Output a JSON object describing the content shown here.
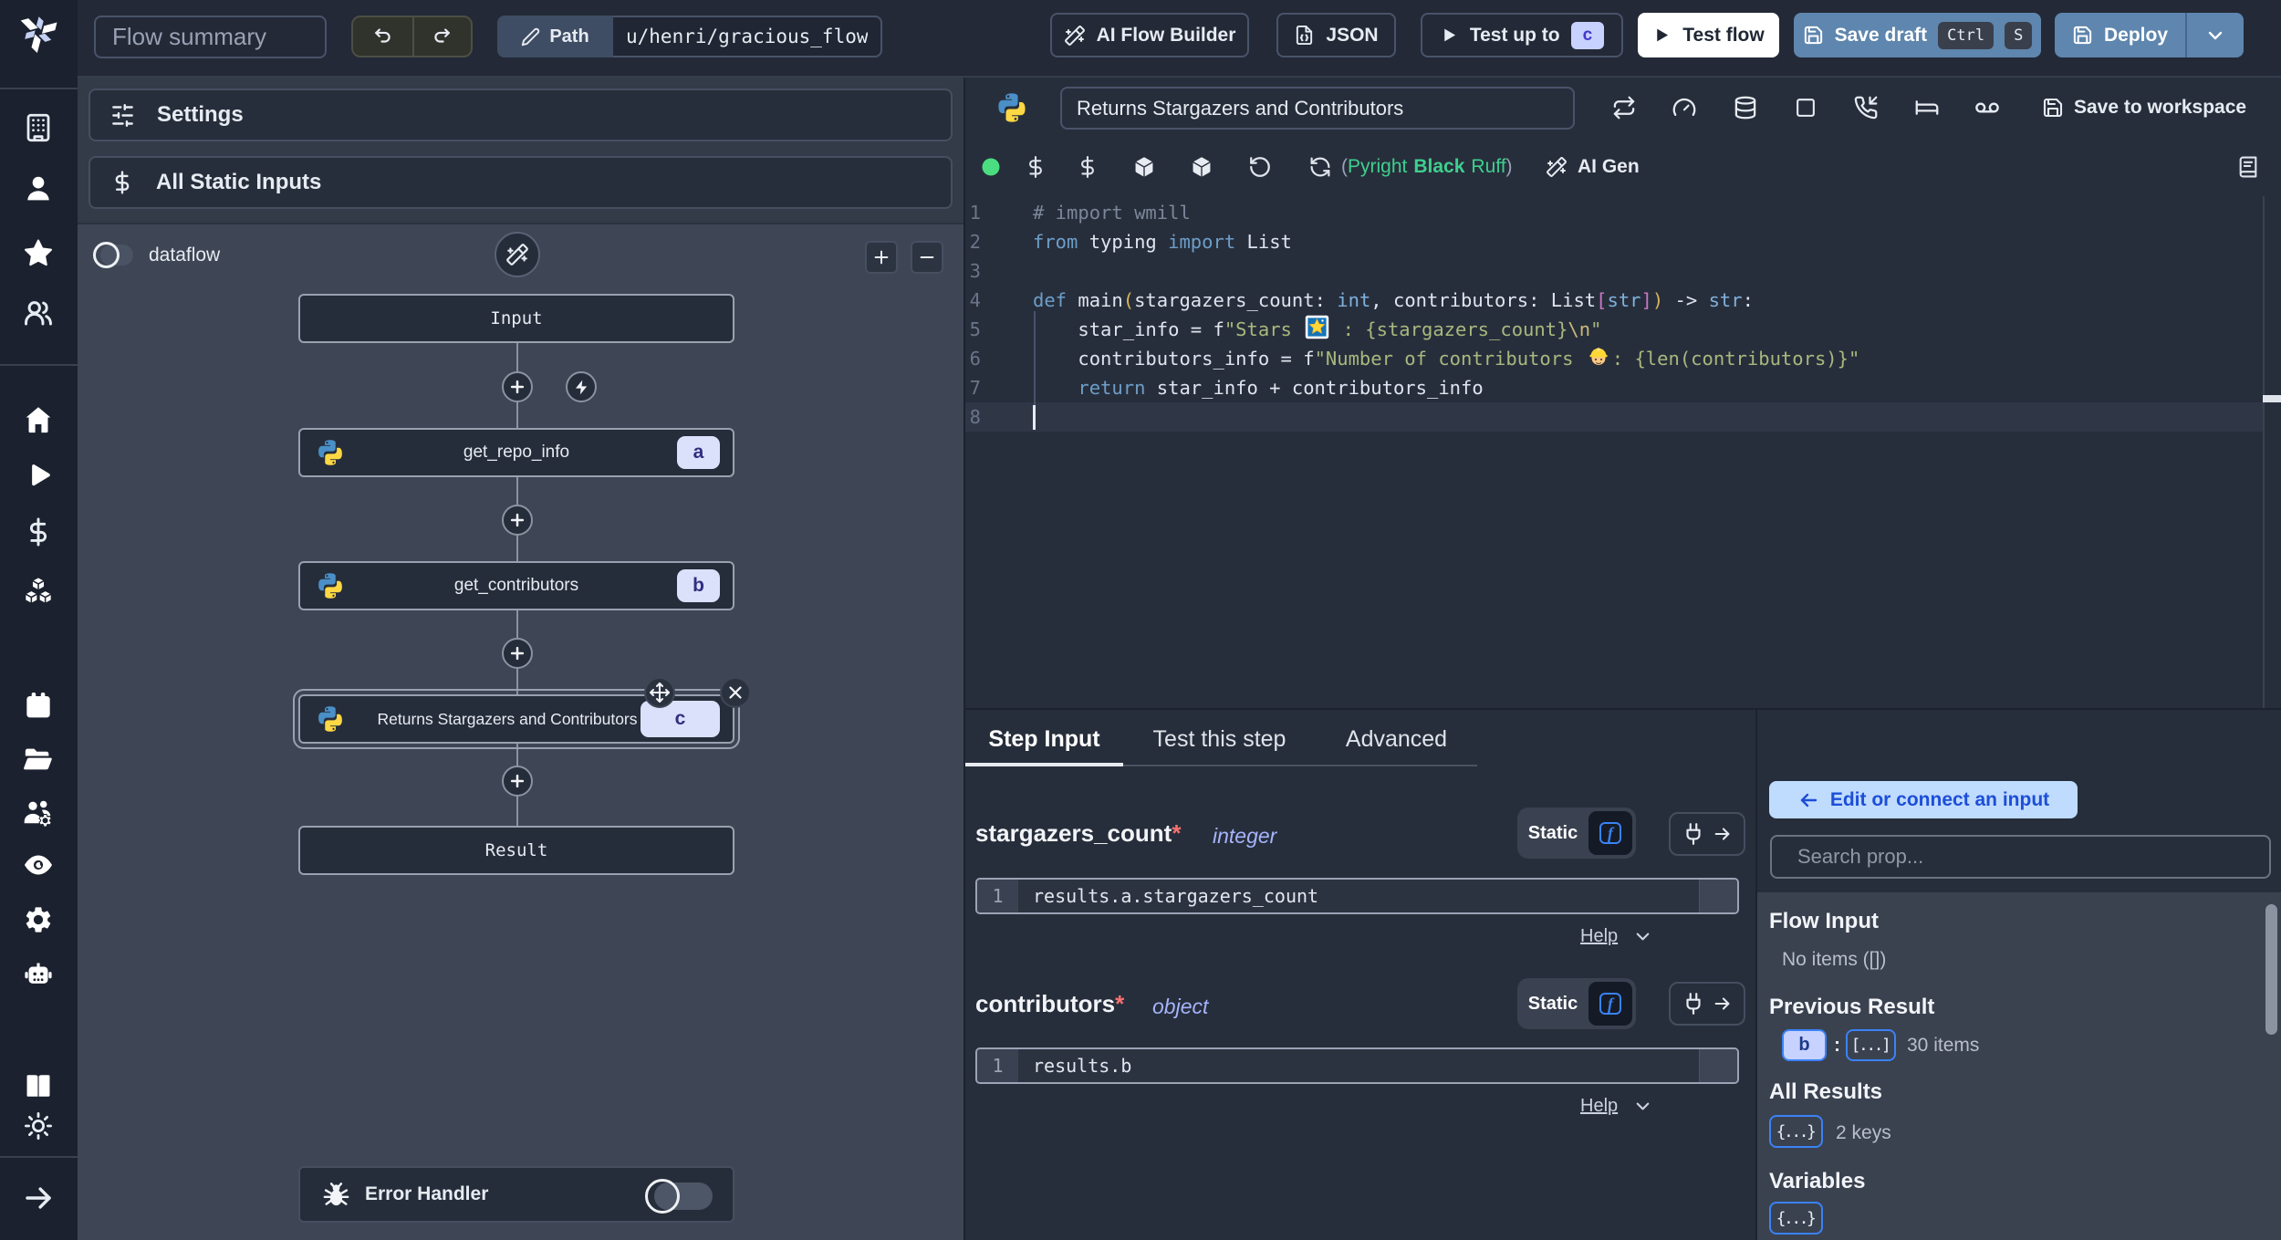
{
  "topbar": {
    "flow_summary_placeholder": "Flow summary",
    "path_label": "Path",
    "path_value": "u/henri/gracious_flow",
    "ai_flow_builder_label": "AI Flow Builder",
    "json_label": "JSON",
    "test_up_to_label": "Test up to",
    "test_up_to_badge": "c",
    "test_flow_label": "Test flow",
    "save_draft_label": "Save draft",
    "save_draft_kbd": [
      "Ctrl",
      "S"
    ],
    "deploy_label": "Deploy"
  },
  "flow_panel": {
    "settings_label": "Settings",
    "all_static_inputs_label": "All Static Inputs",
    "dataflow_label": "dataflow",
    "zoom_in_label": "+",
    "zoom_out_label": "−",
    "input_node_label": "Input",
    "steps": [
      {
        "label": "get_repo_info",
        "badge": "a"
      },
      {
        "label": "get_contributors",
        "badge": "b"
      },
      {
        "label": "Returns Stargazers and Contributors",
        "badge": "c",
        "selected": true
      }
    ],
    "result_node_label": "Result",
    "error_handler_label": "Error Handler"
  },
  "editor": {
    "title_value": "Returns Stargazers and Contributors",
    "save_to_workspace_label": "Save to workspace",
    "lang_status_open": "(",
    "lang_status_items": [
      "Pyright",
      "Black",
      "Ruff"
    ],
    "lang_status_close": ")",
    "ai_gen_label": "AI Gen",
    "line_numbers": [
      "1",
      "2",
      "3",
      "4",
      "5",
      "6",
      "7",
      "8"
    ],
    "code_lines": [
      [
        [
          "cm",
          "# import wmill"
        ]
      ],
      [
        [
          "kw",
          "from"
        ],
        [
          "id",
          " typing "
        ],
        [
          "kw",
          "import"
        ],
        [
          "id",
          " List"
        ]
      ],
      [],
      [
        [
          "kw",
          "def"
        ],
        [
          "id",
          " main"
        ],
        [
          "pa",
          "("
        ],
        [
          "id",
          "stargazers_count: "
        ],
        [
          "ty",
          "int"
        ],
        [
          "id",
          ", contributors: List"
        ],
        [
          "br",
          "["
        ],
        [
          "ty",
          "str"
        ],
        [
          "br",
          "]"
        ],
        [
          "pa",
          ")"
        ],
        [
          "id",
          " -> "
        ],
        [
          "ty",
          "str"
        ],
        [
          "id",
          ":"
        ]
      ],
      [
        [
          "id",
          "    star_info = f"
        ],
        [
          "st",
          "\"Stars "
        ],
        [
          "emstar",
          "🌟"
        ],
        [
          "st",
          " : {stargazers_count}"
        ],
        [
          "es",
          "\\n"
        ],
        [
          "st",
          "\""
        ]
      ],
      [
        [
          "id",
          "    contributors_info = f"
        ],
        [
          "st",
          "\"Number of contributors "
        ],
        [
          "emworker",
          "👷"
        ],
        [
          "st",
          ": {len(contributors)}\""
        ]
      ],
      [
        [
          "kw",
          "    return"
        ],
        [
          "id",
          " star_info + contributors_info"
        ]
      ],
      []
    ]
  },
  "step_panel": {
    "tabs": [
      {
        "label": "Step Input",
        "active": true
      },
      {
        "label": "Test this step",
        "active": false
      },
      {
        "label": "Advanced",
        "active": false
      }
    ],
    "fields": [
      {
        "name": "stargazers_count",
        "required_mark": "*",
        "type": "integer",
        "mode_label": "Static",
        "expr_line_number": "1",
        "expr": "results.a.stargazers_count",
        "help_label": "Help"
      },
      {
        "name": "contributors",
        "required_mark": "*",
        "type": "object",
        "mode_label": "Static",
        "expr_line_number": "1",
        "expr": "results.b",
        "help_label": "Help"
      }
    ]
  },
  "connect_panel": {
    "edit_button_label": "Edit or connect an input",
    "search_placeholder": "Search prop...",
    "flow_input_title": "Flow Input",
    "flow_input_empty": "No items ([])",
    "previous_result_title": "Previous Result",
    "previous_result_key": "b",
    "previous_result_colon": ":",
    "previous_result_badge": "[...]",
    "previous_result_count": "30 items",
    "all_results_title": "All Results",
    "all_results_badge": "{...}",
    "all_results_count": "2 keys",
    "variables_title": "Variables",
    "variables_badge": "{...}"
  },
  "colors": {
    "accent_indigo_badge": "#c7d2fe",
    "accent_blue": "#3b82f6",
    "steel_button": "#5e86ae",
    "status_green_dot": "#4ade80",
    "edit_button_bg": "#bfdbfe",
    "edit_button_fg": "#1d4ed8",
    "lang_status_green": "#3fcf8e"
  }
}
